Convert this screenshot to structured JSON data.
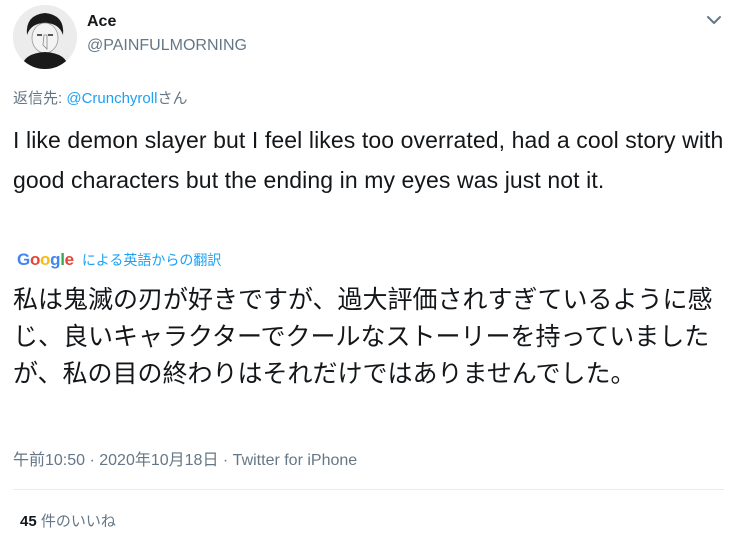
{
  "author": {
    "display_name": "Ace",
    "handle": "@PAINFULMORNING",
    "avatar_icon": "avatar-image"
  },
  "reply": {
    "prefix": "返信先: ",
    "mention": "@Crunchyroll",
    "suffix": "さん"
  },
  "tweet": {
    "text": "I like demon slayer but I feel likes too overrated, had a cool story with good characters but the ending in my eyes was just not it."
  },
  "translation": {
    "provider": "Google",
    "link_label": "による英語からの翻訳",
    "text": "私は鬼滅の刃が好きですが、過大評価されすぎているように感じ、良いキャラクターでクールなストーリーを持っていましたが、私の目の終わりはそれだけではありませんでした。"
  },
  "meta": {
    "timestamp": "午前10:50 · 2020年10月18日",
    "separator": " · ",
    "source": "Twitter for iPhone"
  },
  "likes": {
    "count": "45",
    "label": " 件のいいね"
  },
  "icons": {
    "caret": "chevron-down-icon"
  },
  "colors": {
    "link": "#1da1f2",
    "secondary": "#657786",
    "divider": "#e6ecf0",
    "google_blue": "#4285F4",
    "google_red": "#EA4335",
    "google_yellow": "#FBBC05",
    "google_green": "#34A853"
  }
}
